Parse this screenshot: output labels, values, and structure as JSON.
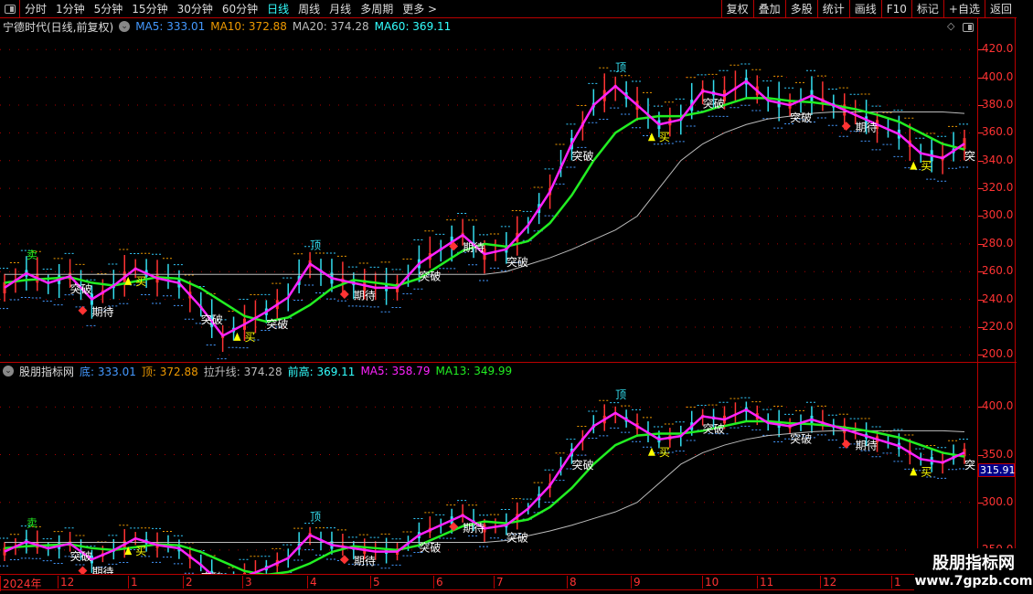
{
  "toolbar": {
    "periods": [
      "分时",
      "1分钟",
      "5分钟",
      "15分钟",
      "30分钟",
      "60分钟",
      "日线",
      "周线",
      "月线",
      "多周期",
      "更多 >"
    ],
    "active": "日线",
    "right_buttons": [
      "复权",
      "叠加",
      "多股",
      "统计",
      "画线",
      "F10",
      "标记",
      "+自选",
      "返回"
    ]
  },
  "main_header": {
    "title": "宁德时代(日线,前复权)",
    "ma5": "MA5: 333.01",
    "ma10": "MA10: 372.88",
    "ma20": "MA20: 374.28",
    "ma60": "MA60: 369.11"
  },
  "sub_header": {
    "title": "股朋指标网",
    "di": "底: 333.01",
    "ding": "顶: 372.88",
    "lashen": "拉升线: 374.28",
    "qiangao": "前高: 369.11",
    "ma5": "MA5: 358.79",
    "ma13": "MA13: 349.99"
  },
  "last_value": "315.91",
  "logo": {
    "name": "股朋指标网",
    "url": "www.7gpzb.com"
  },
  "colors": {
    "ma5": "#ff22ff",
    "ma13": "#22ee22",
    "ma60": "#bbbbbb",
    "up": "#ff3333",
    "down": "#33ddee",
    "axis": "#ff3333",
    "grid": "#aa0000"
  },
  "chart_data": [
    {
      "type": "line",
      "panel": "main",
      "ylim": [
        195,
        430
      ],
      "y_ticks": [
        "420.0",
        "400.0",
        "380.0",
        "360.0",
        "340.0",
        "320.0",
        "300.0",
        "280.0",
        "260.0",
        "240.0",
        "220.0",
        "200.0"
      ],
      "x_ticks": [
        "2024年",
        "12",
        "1",
        "2",
        "3",
        "4",
        "5",
        "6",
        "7",
        "8",
        "9",
        "10",
        "11",
        "12",
        "1"
      ],
      "series": [
        {
          "name": "MA5",
          "values": [
            248.4,
            258.8,
            251.8,
            256.7,
            240.1,
            249.8,
            262.2,
            255.3,
            251.8,
            234.5,
            213.8,
            222.1,
            231.1,
            241.5,
            265.7,
            255.3,
            251.8,
            248.4,
            248.4,
            265.7,
            276.1,
            286.4,
            272.6,
            276.1,
            293.4,
            317.6,
            352.2,
            379.9,
            393.7,
            379.9,
            366.0,
            369.5,
            390.2,
            386.8,
            397.2,
            383.3,
            379.9,
            386.8,
            379.9,
            372.9,
            366.0,
            359.1,
            345.3,
            341.8,
            352.2
          ]
        },
        {
          "name": "MA13",
          "values": [
            252,
            254,
            255,
            256,
            252,
            250,
            253,
            256,
            255,
            248,
            238,
            228,
            224,
            227,
            236,
            248,
            254,
            252,
            250,
            255,
            265,
            275,
            280,
            278,
            282,
            295,
            315,
            340,
            360,
            370,
            372,
            372,
            375,
            380,
            385,
            385,
            383,
            382,
            380,
            377,
            373,
            368,
            360,
            352,
            348
          ]
        },
        {
          "name": "MA60",
          "values": [
            258,
            258,
            258,
            258,
            258,
            258,
            258,
            258,
            258,
            258,
            258,
            258,
            258,
            258,
            258,
            258,
            258,
            258,
            258,
            258,
            258,
            258,
            258,
            260,
            265,
            270,
            276,
            283,
            290,
            300,
            320,
            340,
            352,
            360,
            366,
            370,
            372,
            374,
            375,
            375,
            375,
            375,
            375,
            375,
            374
          ]
        }
      ],
      "annotations": [
        {
          "i": 1,
          "text": "卖",
          "color": "#22ee22"
        },
        {
          "i": 3,
          "text": "突破",
          "color": "#ffffff"
        },
        {
          "i": 4,
          "text": "期待",
          "color": "#ffffff"
        },
        {
          "i": 6,
          "text": "买",
          "color": "#ffff00"
        },
        {
          "i": 9,
          "text": "突破",
          "color": "#ffffff"
        },
        {
          "i": 11,
          "text": "买",
          "color": "#ffff00"
        },
        {
          "i": 12,
          "text": "突破",
          "color": "#ffffff"
        },
        {
          "i": 14,
          "text": "顶",
          "color": "#33ddee"
        },
        {
          "i": 16,
          "text": "期待",
          "color": "#ffffff"
        },
        {
          "i": 19,
          "text": "突破",
          "color": "#ffffff"
        },
        {
          "i": 21,
          "text": "期待",
          "color": "#ffffff"
        },
        {
          "i": 23,
          "text": "突破",
          "color": "#ffffff"
        },
        {
          "i": 26,
          "text": "突破",
          "color": "#ffffff"
        },
        {
          "i": 28,
          "text": "顶",
          "color": "#33ddee"
        },
        {
          "i": 30,
          "text": "买",
          "color": "#ffff00"
        },
        {
          "i": 32,
          "text": "突破",
          "color": "#ffffff"
        },
        {
          "i": 36,
          "text": "突破",
          "color": "#ffffff"
        },
        {
          "i": 39,
          "text": "期待",
          "color": "#ffffff"
        },
        {
          "i": 42,
          "text": "买",
          "color": "#ffff00"
        },
        {
          "i": 44,
          "text": "突",
          "color": "#ffffff"
        }
      ]
    },
    {
      "type": "line",
      "panel": "indicator",
      "ylim": [
        225,
        430
      ],
      "y_ticks": [
        "400.0",
        "350.0",
        "300.0",
        "250.0"
      ]
    }
  ]
}
